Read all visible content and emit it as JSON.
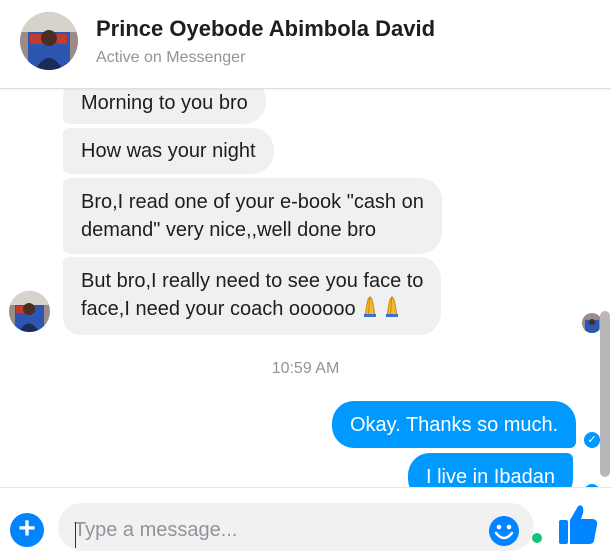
{
  "header": {
    "name": "Prince Oyebode Abimbola David",
    "status": "Active on Messenger"
  },
  "messages": {
    "incoming": [
      {
        "text": "Morning to you bro"
      },
      {
        "text": "How was your night"
      },
      {
        "lines": [
          "Bro,I read one of your e-book \"cash on",
          "demand\" very nice,,well done bro"
        ]
      },
      {
        "lines": [
          "But bro,I really need to see you face to",
          "face,I need your coach oooooo"
        ],
        "emoji": "praying-hands"
      }
    ],
    "timestamp": "10:59 AM",
    "outgoing": [
      {
        "text": "Okay. Thanks so much.",
        "status": "delivered"
      },
      {
        "text": "I live in Ibadan",
        "status": "delivered"
      }
    ]
  },
  "composer": {
    "placeholder": "Type a message..."
  },
  "colors": {
    "outgoing_bubble": "#0099ff",
    "incoming_bubble": "#f1f0f0",
    "accent": "#0084ff"
  },
  "icons": [
    "profile-avatar",
    "add-icon",
    "emoji-icon",
    "thumbs-up-icon",
    "check-icon",
    "praying-hands-emoji"
  ]
}
